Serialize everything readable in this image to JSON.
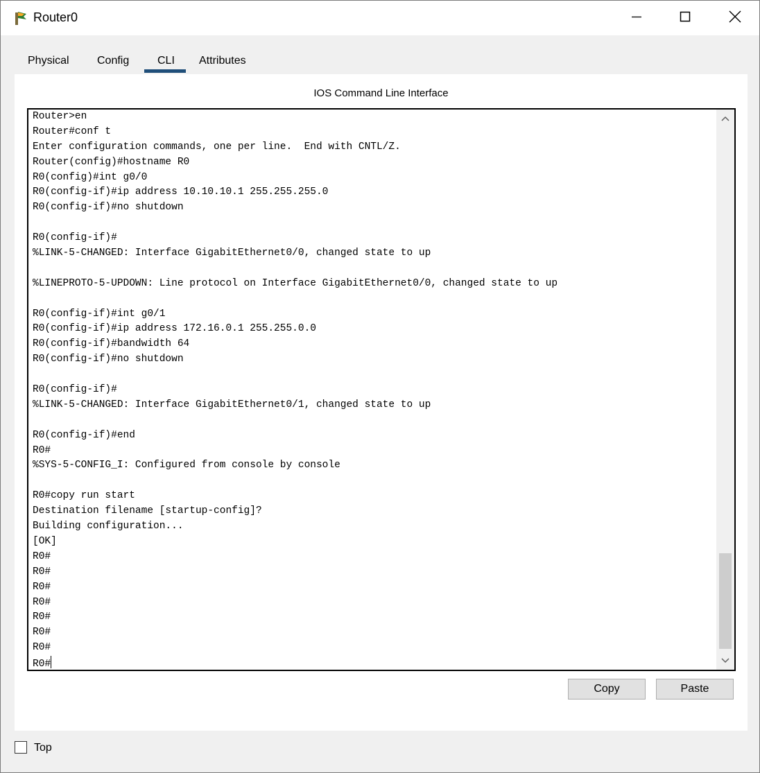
{
  "window": {
    "title": "Router0"
  },
  "tabs": [
    {
      "label": "Physical"
    },
    {
      "label": "Config"
    },
    {
      "label": "CLI"
    },
    {
      "label": "Attributes"
    }
  ],
  "active_tab": "CLI",
  "cli": {
    "heading": "IOS Command Line Interface",
    "lines": [
      "Router>en",
      "Router#conf t",
      "Enter configuration commands, one per line.  End with CNTL/Z.",
      "Router(config)#hostname R0",
      "R0(config)#int g0/0",
      "R0(config-if)#ip address 10.10.10.1 255.255.255.0",
      "R0(config-if)#no shutdown",
      "",
      "R0(config-if)#",
      "%LINK-5-CHANGED: Interface GigabitEthernet0/0, changed state to up",
      "",
      "%LINEPROTO-5-UPDOWN: Line protocol on Interface GigabitEthernet0/0, changed state to up",
      "",
      "R0(config-if)#int g0/1",
      "R0(config-if)#ip address 172.16.0.1 255.255.0.0",
      "R0(config-if)#bandwidth 64",
      "R0(config-if)#no shutdown",
      "",
      "R0(config-if)#",
      "%LINK-5-CHANGED: Interface GigabitEthernet0/1, changed state to up",
      "",
      "R0(config-if)#end",
      "R0#",
      "%SYS-5-CONFIG_I: Configured from console by console",
      "",
      "R0#copy run start",
      "Destination filename [startup-config]?",
      "Building configuration...",
      "[OK]",
      "R0#",
      "R0#",
      "R0#",
      "R0#",
      "R0#",
      "R0#",
      "R0#",
      "R0#"
    ]
  },
  "buttons": {
    "copy": "Copy",
    "paste": "Paste"
  },
  "top_checkbox": {
    "label": "Top",
    "checked": false
  },
  "colors": {
    "tab_underline": "#1f4e79",
    "window_bg": "#f0f0f0",
    "terminal_border": "#000000"
  },
  "icons": {
    "app": "router-app-icon",
    "minimize": "minimize-icon",
    "maximize": "maximize-icon",
    "close": "close-icon",
    "scroll_up": "chevron-up-icon",
    "scroll_down": "chevron-down-icon"
  }
}
